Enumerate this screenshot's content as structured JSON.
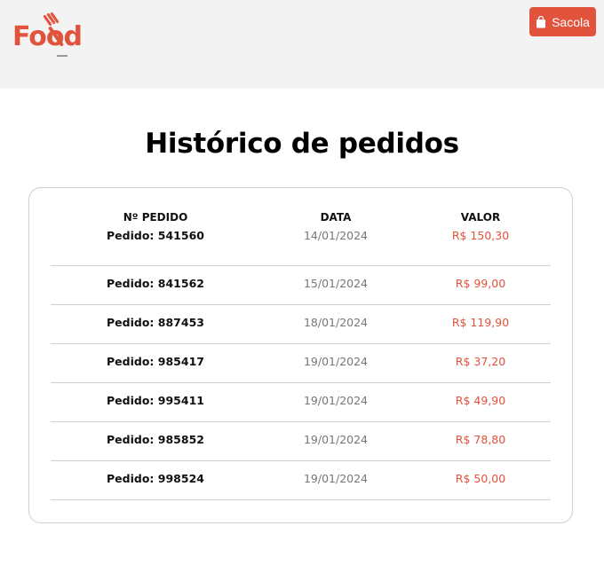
{
  "header": {
    "logo_text": "Food",
    "bag_button_label": "Sacola"
  },
  "page": {
    "title": "Histórico de pedidos"
  },
  "table": {
    "headers": [
      "Nº PEDIDO",
      "DATA",
      "VALOR"
    ],
    "rows": [
      {
        "order": "Pedido: 541560",
        "date": "14/01/2024",
        "value": "R$ 150,30"
      },
      {
        "order": "Pedido: 841562",
        "date": "15/01/2024",
        "value": "R$ 99,00"
      },
      {
        "order": "Pedido: 887453",
        "date": "18/01/2024",
        "value": "R$ 119,90"
      },
      {
        "order": "Pedido: 985417",
        "date": "19/01/2024",
        "value": "R$ 37,20"
      },
      {
        "order": "Pedido: 995411",
        "date": "19/01/2024",
        "value": "R$ 49,90"
      },
      {
        "order": "Pedido: 985852",
        "date": "19/01/2024",
        "value": "R$ 78,80"
      },
      {
        "order": "Pedido: 998524",
        "date": "19/01/2024",
        "value": "R$ 50,00"
      }
    ]
  },
  "colors": {
    "accent": "#e2533e",
    "header_bg": "#f3f3f3",
    "border": "#cfcfcf",
    "date_text": "#777777"
  },
  "icons": {
    "logo": "fork-icon",
    "bag": "shopping-bag-icon"
  }
}
